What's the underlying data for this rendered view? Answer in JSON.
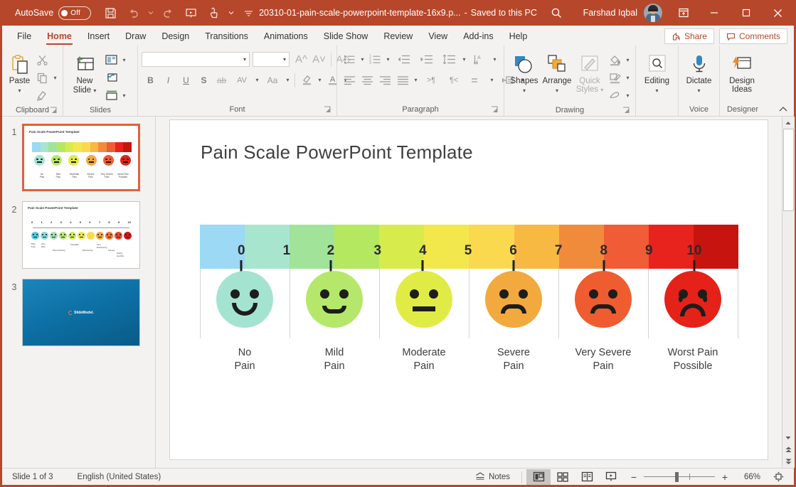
{
  "titlebar": {
    "autosave_label": "AutoSave",
    "autosave_state": "Off",
    "filename": "20310-01-pain-scale-powerpoint-template-16x9.p...",
    "separator": "-",
    "save_state": "Saved to this PC",
    "user_name": "Farshad Iqbal",
    "icons": [
      "save-icon",
      "undo-icon",
      "redo-icon",
      "start-from-beginning-icon",
      "touch-mode-icon",
      "customize-quick-access-icon"
    ],
    "window_minimize": "—",
    "window_maximize": "☐",
    "window_close": "✕"
  },
  "tabs": [
    {
      "label": "File",
      "active": false
    },
    {
      "label": "Home",
      "active": true
    },
    {
      "label": "Insert",
      "active": false
    },
    {
      "label": "Draw",
      "active": false
    },
    {
      "label": "Design",
      "active": false
    },
    {
      "label": "Transitions",
      "active": false
    },
    {
      "label": "Animations",
      "active": false
    },
    {
      "label": "Slide Show",
      "active": false
    },
    {
      "label": "Review",
      "active": false
    },
    {
      "label": "View",
      "active": false
    },
    {
      "label": "Add-ins",
      "active": false
    },
    {
      "label": "Help",
      "active": false
    }
  ],
  "tabs_right": {
    "share_label": "Share",
    "comments_label": "Comments"
  },
  "ribbon": {
    "groups": [
      {
        "name": "Clipboard",
        "label": "Clipboard"
      },
      {
        "name": "Slides",
        "label": "Slides"
      },
      {
        "name": "Font",
        "label": "Font"
      },
      {
        "name": "Paragraph",
        "label": "Paragraph"
      },
      {
        "name": "Drawing",
        "label": "Drawing"
      },
      {
        "name": "Editing",
        "label": ""
      },
      {
        "name": "Voice",
        "label": "Voice"
      },
      {
        "name": "Designer",
        "label": "Designer"
      }
    ],
    "clipboard": {
      "paste_label": "Paste",
      "cut_label": "Cut",
      "copy_label": "Copy",
      "format_painter_label": "Format Painter"
    },
    "slides": {
      "new_slide_label": "New\nSlide",
      "new_slide_line1": "New",
      "new_slide_line2": "Slide",
      "layout_label": "Layout",
      "reset_label": "Reset",
      "section_label": "Section"
    },
    "font": {
      "font_name_value": "",
      "font_name_placeholder": "",
      "font_size_value": "",
      "bold": "B",
      "italic": "I",
      "underline": "U",
      "shadow": "S",
      "strikethrough": "ab",
      "char_spacing": "AV",
      "change_case": "Aa"
    },
    "drawing": {
      "shapes_label": "Shapes",
      "arrange_label": "Arrange",
      "quick_styles_line1": "Quick",
      "quick_styles_line2": "Styles"
    },
    "editing": {
      "editing_label": "Editing"
    },
    "voice": {
      "dictate_label": "Dictate"
    },
    "designer": {
      "design_ideas_line1": "Design",
      "design_ideas_line2": "Ideas"
    },
    "collapse_ribbon_icon": "chevron-up-icon"
  },
  "thumbnails": [
    {
      "number": "1",
      "selected": true,
      "title": "Pain Scale PowerPoint Template"
    },
    {
      "number": "2",
      "selected": false,
      "title": "Pain Scale PowerPoint Template"
    },
    {
      "number": "3",
      "selected": false,
      "title": "SlideModel."
    }
  ],
  "slide": {
    "title": "Pain Scale PowerPoint Template",
    "scale_numbers": [
      "0",
      "1",
      "2",
      "3",
      "4",
      "5",
      "6",
      "7",
      "8",
      "9",
      "10"
    ],
    "bar_colors": [
      "#9bd9f4",
      "#a8e5cf",
      "#a2e39a",
      "#b5e861",
      "#d7ec4c",
      "#f2e84b",
      "#fbd94f",
      "#f7b942",
      "#f08b3c",
      "#ef5c36",
      "#e8231e",
      "#c8140f"
    ],
    "faces": [
      {
        "label_line1": "No",
        "label_line2": "Pain",
        "color": "#a5e3d1",
        "mouth": "smile"
      },
      {
        "label_line1": "Mild",
        "label_line2": "Pain",
        "color": "#b5e86a",
        "mouth": "smile-small"
      },
      {
        "label_line1": "Moderate",
        "label_line2": "Pain",
        "color": "#e0ec45",
        "mouth": "flat"
      },
      {
        "label_line1": "Severe",
        "label_line2": "Pain",
        "color": "#f2a93e",
        "mouth": "frown"
      },
      {
        "label_line1": "Very Severe",
        "label_line2": "Pain",
        "color": "#ef5c30",
        "mouth": "frown"
      },
      {
        "label_line1": "Worst Pain",
        "label_line2": "Possible",
        "color": "#e42219",
        "mouth": "frown-deep-tears"
      }
    ]
  },
  "statusbar": {
    "slide_counter": "Slide 1 of 3",
    "language": "English (United States)",
    "notes_label": "Notes",
    "views": [
      {
        "name": "normal-view",
        "active": true
      },
      {
        "name": "slide-sorter-view",
        "active": false
      },
      {
        "name": "reading-view",
        "active": false
      },
      {
        "name": "slide-show-view",
        "active": false
      }
    ],
    "zoom_out": "−",
    "zoom_in": "+",
    "zoom_level": "66%"
  }
}
